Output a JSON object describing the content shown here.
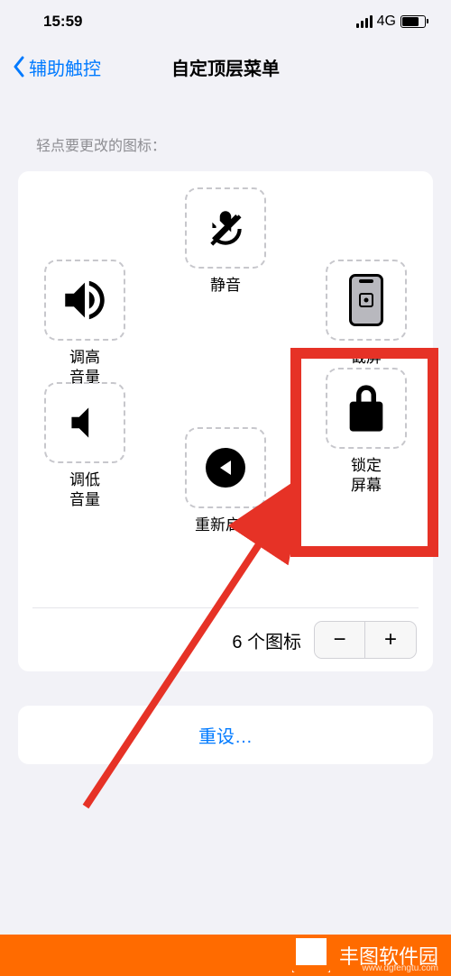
{
  "status": {
    "time": "15:59",
    "network": "4G"
  },
  "nav": {
    "back": "辅助触控",
    "title": "自定顶层菜单"
  },
  "hint": "轻点要更改的图标：",
  "icons": {
    "mute": "静音",
    "volup": "调高\n音量",
    "voldown": "调低\n音量",
    "screenshot": "截屏",
    "restart": "重新启动",
    "lock": "锁定\n屏幕"
  },
  "stepper": {
    "label": "6 个图标"
  },
  "reset": "重设…",
  "watermark": {
    "brand": "丰图软件园",
    "domain": "www.dgfengtu.com"
  }
}
